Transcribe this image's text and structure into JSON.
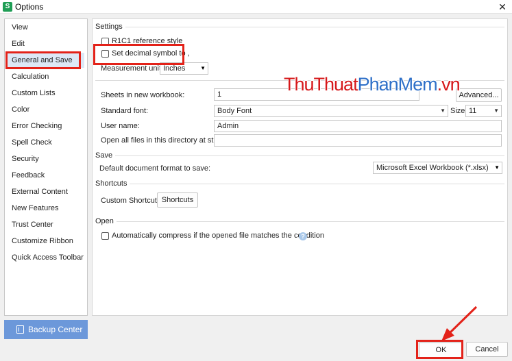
{
  "window": {
    "title": "Options",
    "app_icon_letter": "S"
  },
  "sidebar": {
    "items": [
      {
        "label": "View"
      },
      {
        "label": "Edit"
      },
      {
        "label": "General and Save",
        "selected": true
      },
      {
        "label": "Calculation"
      },
      {
        "label": "Custom Lists"
      },
      {
        "label": "Color"
      },
      {
        "label": "Error Checking"
      },
      {
        "label": "Spell Check"
      },
      {
        "label": "Security"
      },
      {
        "label": "Feedback"
      },
      {
        "label": "External Content"
      },
      {
        "label": "New Features"
      },
      {
        "label": "Trust Center"
      },
      {
        "label": "Customize Ribbon"
      },
      {
        "label": "Quick Access Toolbar"
      }
    ],
    "backup_center_label": "Backup Center"
  },
  "settings": {
    "section_label": "Settings",
    "r1c1_label": "R1C1 reference style",
    "r1c1_checked": false,
    "decimal_label": "Set decimal symbol to ,",
    "decimal_checked": false,
    "measurement_label": "Measurement units:",
    "measurement_value": "Inches",
    "sheets_label": "Sheets in new workbook:",
    "sheets_value": "1",
    "advanced_label": "Advanced...",
    "font_label": "Standard font:",
    "font_value": "Body Font",
    "size_label": "Size:",
    "size_value": "11",
    "username_label": "User name:",
    "username_value": "Admin",
    "open_dir_label": "Open all files in this directory at startup:",
    "open_dir_value": ""
  },
  "save": {
    "section_label": "Save",
    "format_label": "Default document format to save:",
    "format_value": "Microsoft Excel Workbook (*.xlsx)"
  },
  "shortcuts": {
    "section_label": "Shortcuts",
    "custom_label": "Custom Shortcuts:",
    "button_label": "Shortcuts"
  },
  "open": {
    "section_label": "Open",
    "compress_label": "Automatically compress if the opened file matches the condition",
    "compress_checked": false,
    "help_glyph": "?"
  },
  "footer": {
    "ok_label": "OK",
    "cancel_label": "Cancel"
  },
  "watermark": {
    "part1": "ThuThuat",
    "part2": "PhanMem",
    "part3": ".vn"
  },
  "icons": {
    "close": "close-icon",
    "help": "help-icon",
    "dropdown": "chevron-down-icon",
    "backup": "backup-icon"
  },
  "colors": {
    "highlight_red": "#e32219",
    "selected_item_bg": "#dde8f6",
    "backup_button_bg": "#6c98da",
    "app_icon_green": "#1f9d55",
    "watermark_red": "#d6191b",
    "watermark_blue": "#2f70c8"
  }
}
